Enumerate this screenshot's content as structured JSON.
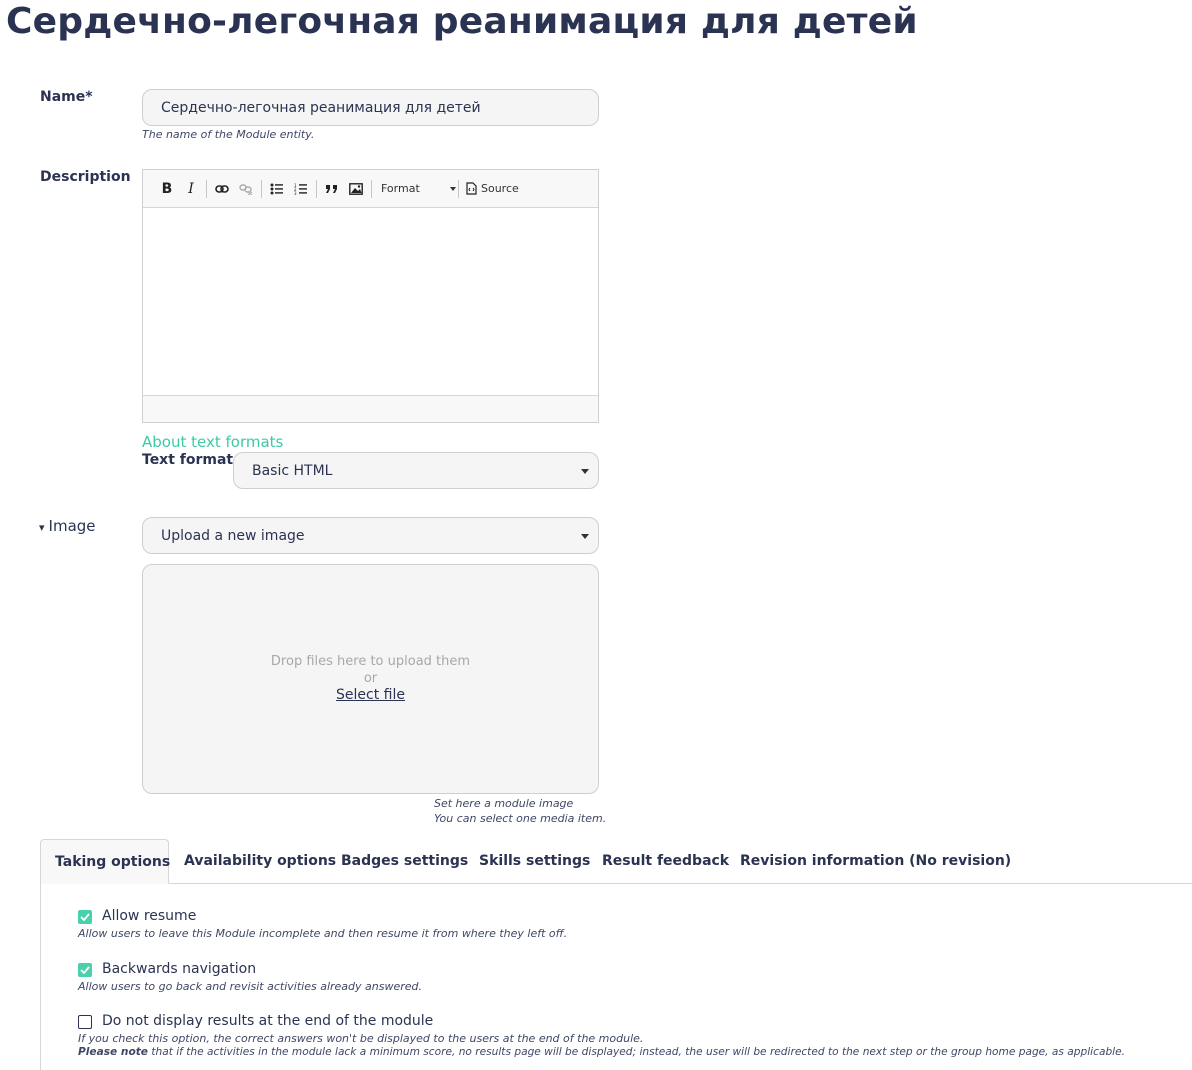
{
  "page": {
    "title": "Сердечно-легочная реанимация для детей"
  },
  "name_field": {
    "label": "Name",
    "required_mark": "*",
    "value": "Сердечно-легочная реанимация для детей",
    "help": "The name of the Module entity."
  },
  "description": {
    "label": "Description",
    "toolbar": {
      "bold": "B",
      "italic": "I",
      "format_label": "Format",
      "source_label": "Source"
    },
    "about_formats": "About text formats",
    "text_format_label": "Text format",
    "text_format_value": "Basic HTML"
  },
  "image": {
    "label": "Image",
    "toggle_glyph": "▾",
    "source_value": "Upload a new image",
    "drop_text": "Drop files here to upload them",
    "or_text": "or",
    "select_file": "Select file",
    "help_line1": "Set here a module image",
    "help_line2": "You can select one media item."
  },
  "tabs": [
    {
      "label": "Taking options",
      "active": true
    },
    {
      "label": "Availability options"
    },
    {
      "label": "Badges settings"
    },
    {
      "label": "Skills settings"
    },
    {
      "label": "Result feedback"
    },
    {
      "label": "Revision information (No revision)"
    }
  ],
  "options": {
    "allow_resume": {
      "label": "Allow resume",
      "checked": true,
      "help": "Allow users to leave this Module incomplete and then resume it from where they left off."
    },
    "backwards_navigation": {
      "label": "Backwards navigation",
      "checked": true,
      "help": "Allow users to go back and revisit activities already answered."
    },
    "hide_results": {
      "label": "Do not display results at the end of the module",
      "checked": false,
      "help": "If you check this option, the correct answers won't be displayed to the users at the end of the module.",
      "note_bold": "Please note",
      "note_rest": " that if the activities in the module lack a minimum score, no results page will be displayed; instead, the user will be redirected to the next step or the group home page, as applicable."
    }
  },
  "colors": {
    "accent": "#3cc9a4",
    "checkbox": "#49d1ad",
    "text": "#2b3353"
  }
}
